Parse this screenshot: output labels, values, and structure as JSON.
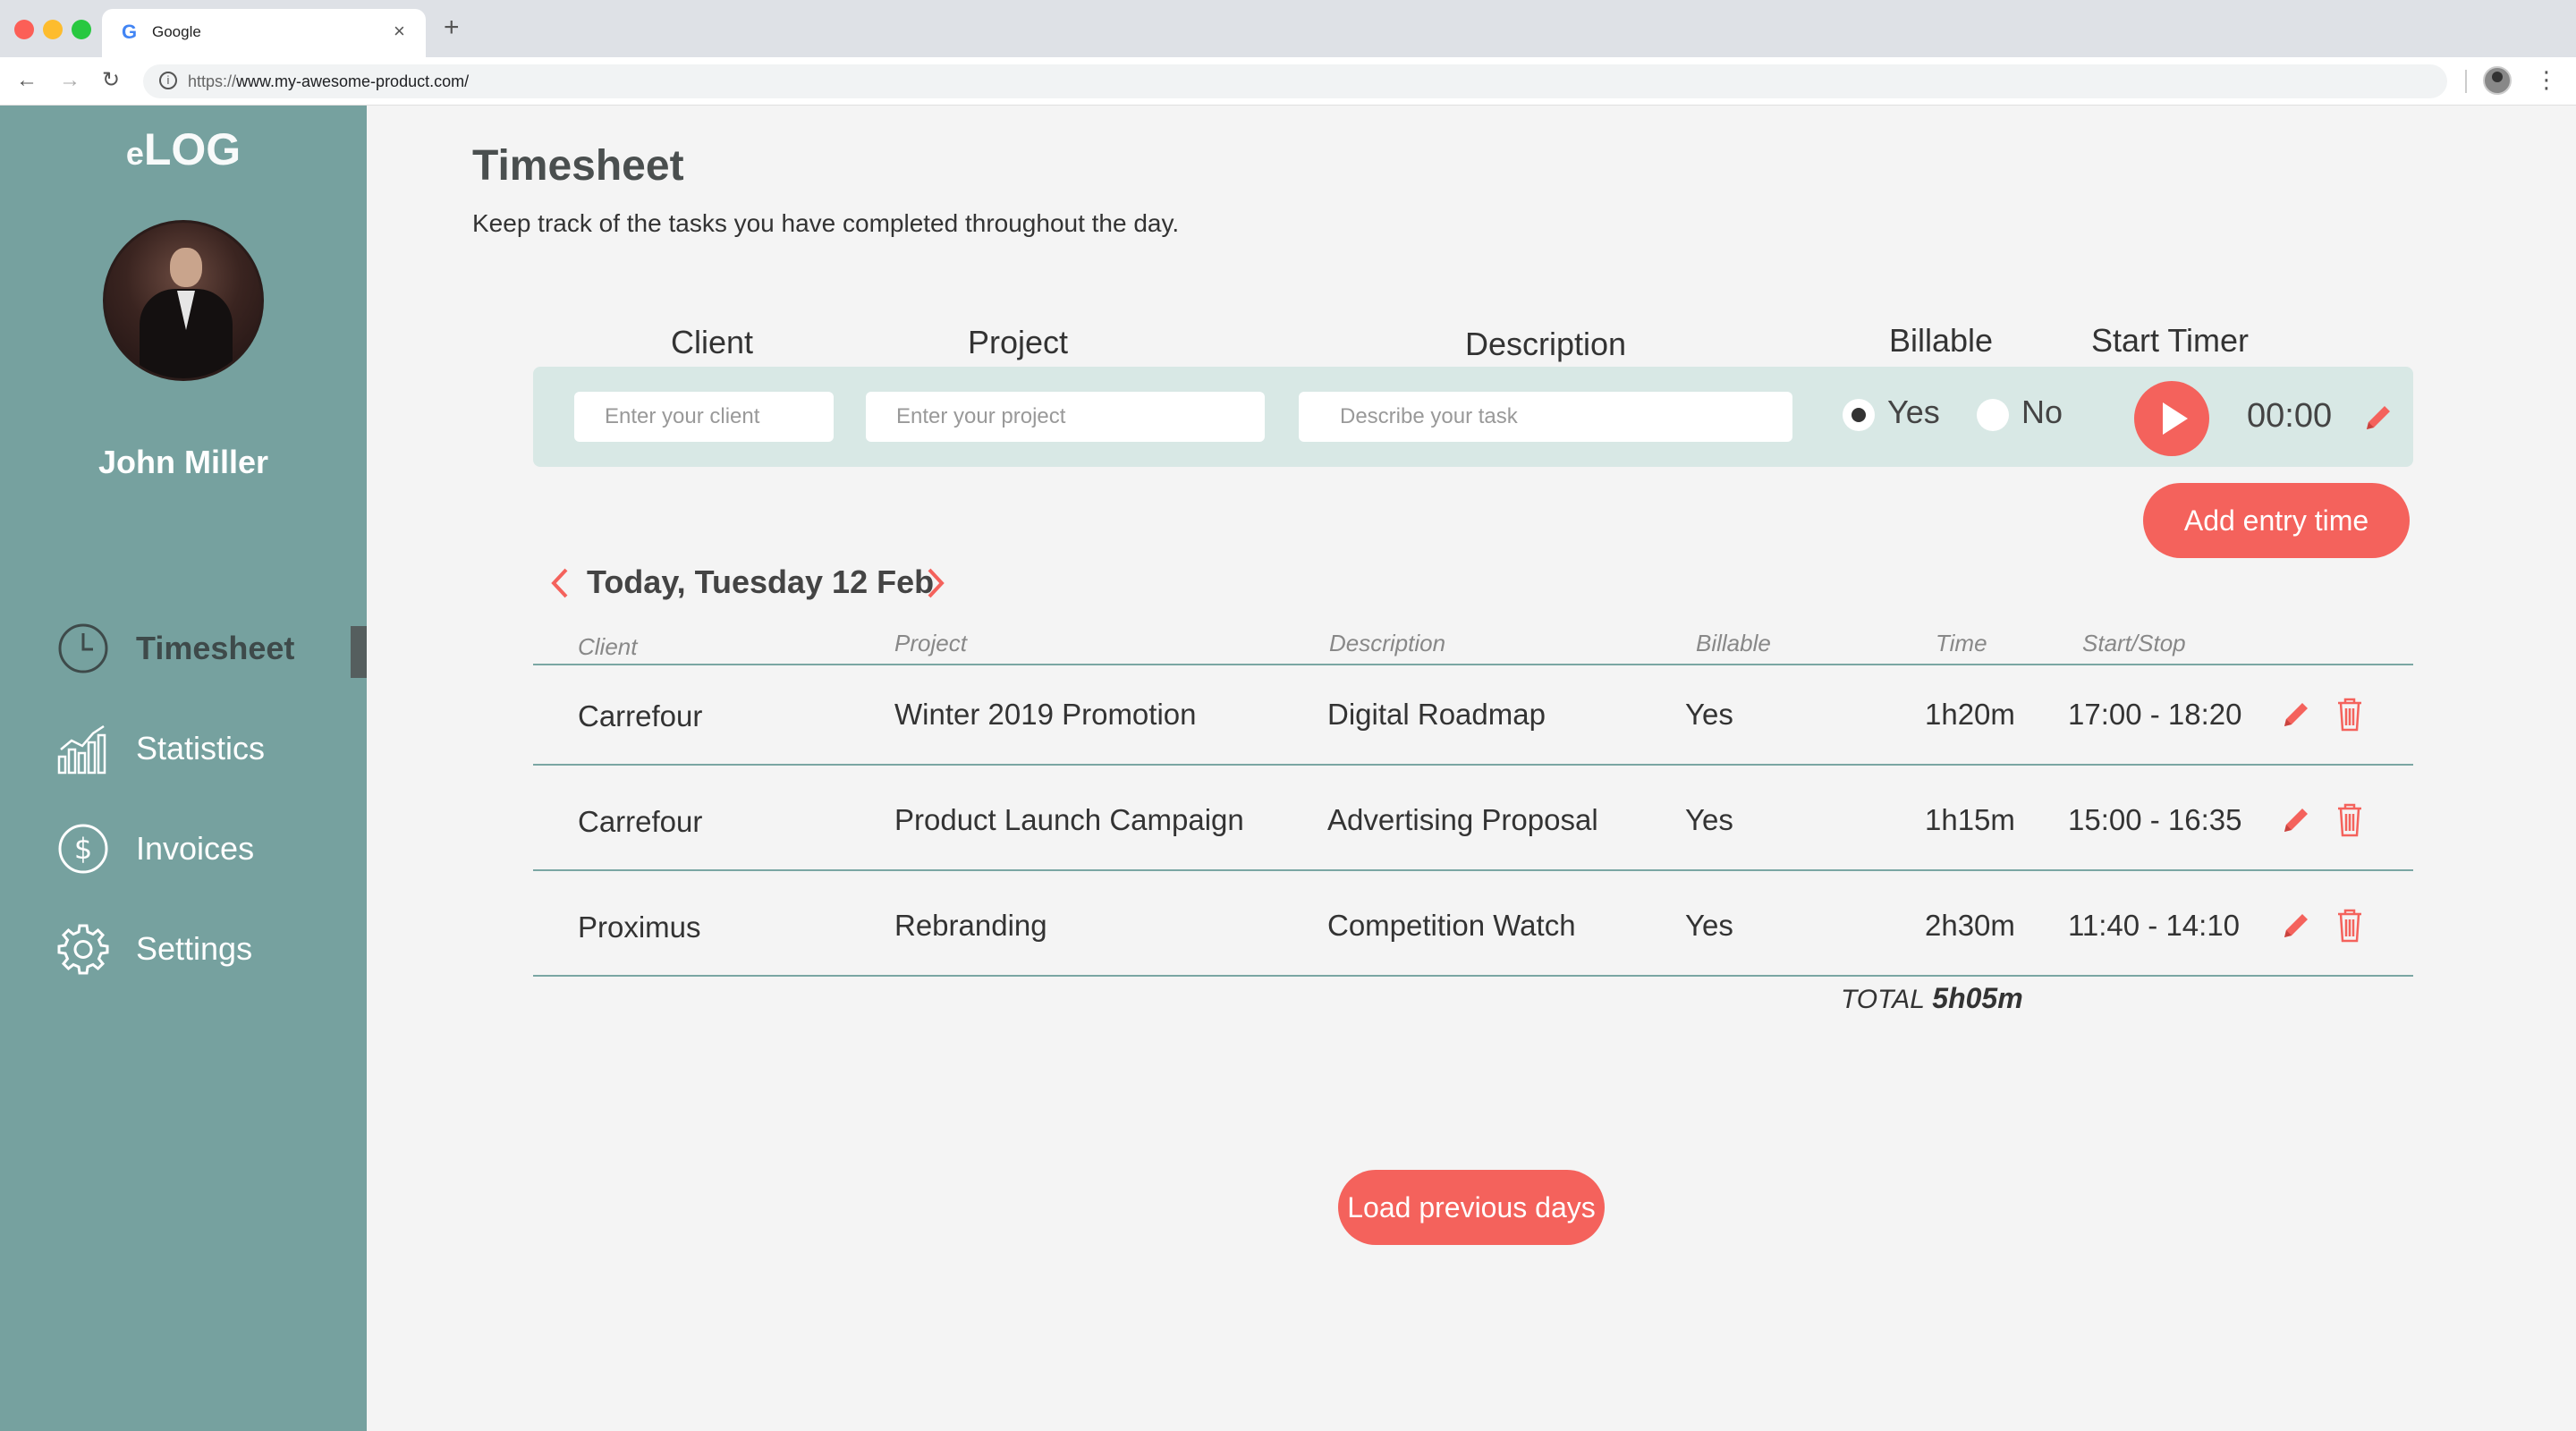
{
  "browser": {
    "tab_title": "Google",
    "tab_favicon": "G",
    "url_scheme": "https://",
    "url_host": "www.my-awesome-product.com/"
  },
  "sidebar": {
    "logo_prefix": "e",
    "logo_main": "LOG",
    "user_name": "John Miller",
    "items": [
      {
        "label": "Timesheet",
        "icon": "clock-icon",
        "active": true
      },
      {
        "label": "Statistics",
        "icon": "bar-chart-icon",
        "active": false
      },
      {
        "label": "Invoices",
        "icon": "dollar-icon",
        "active": false
      },
      {
        "label": "Settings",
        "icon": "gear-icon",
        "active": false
      }
    ]
  },
  "header": {
    "title": "Timesheet",
    "subtitle": "Keep track of the tasks you have completed throughout the day."
  },
  "entry_form": {
    "headers": {
      "client": "Client",
      "project": "Project",
      "description": "Description",
      "billable": "Billable",
      "start_timer": "Start Timer"
    },
    "client_placeholder": "Enter your client",
    "project_placeholder": "Enter your project",
    "description_placeholder": "Describe your task",
    "billable_yes": "Yes",
    "billable_no": "No",
    "billable_selected": "Yes",
    "timer_value": "00:00",
    "add_button": "Add entry time"
  },
  "day": {
    "label": "Today, Tuesday 12 Feb"
  },
  "table": {
    "headers": {
      "client": "Client",
      "project": "Project",
      "description": "Description",
      "billable": "Billable",
      "time": "Time",
      "start_stop": "Start/Stop"
    },
    "rows": [
      {
        "client": "Carrefour",
        "project": "Winter 2019 Promotion",
        "description": "Digital Roadmap",
        "billable": "Yes",
        "time": "1h20m",
        "start_stop": "17:00 - 18:20"
      },
      {
        "client": "Carrefour",
        "project": "Product Launch Campaign",
        "description": "Advertising Proposal",
        "billable": "Yes",
        "time": "1h15m",
        "start_stop": "15:00 - 16:35"
      },
      {
        "client": "Proximus",
        "project": "Rebranding",
        "description": "Competition Watch",
        "billable": "Yes",
        "time": "2h30m",
        "start_stop": "11:40 - 14:10"
      }
    ],
    "total_label": "TOTAL",
    "total_value": "5h05m"
  },
  "load_button": "Load previous days",
  "colors": {
    "sidebar": "#76a19f",
    "accent": "#f4625c",
    "panel": "#d8e8e5",
    "background": "#f4f4f4"
  }
}
